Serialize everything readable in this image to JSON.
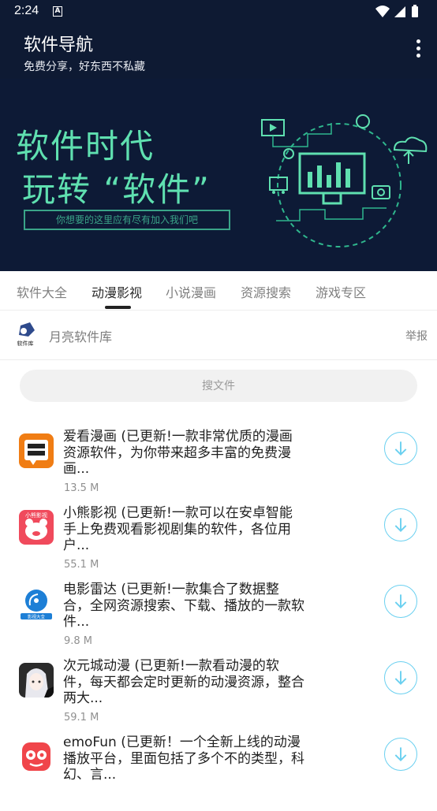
{
  "status_bar": {
    "time": "2:24",
    "notification_icon": "A"
  },
  "app_bar": {
    "title": "软件导航",
    "subtitle": "免费分享，好东西不私藏",
    "more_icon": "more-vert-icon"
  },
  "banner": {
    "line1": "软件时代",
    "line2": "玩转 “软件”",
    "pill_text": "你想要的这里应有尽有加入我们吧"
  },
  "tabs": [
    {
      "label": "软件大全",
      "active": false
    },
    {
      "label": "动漫影视",
      "active": true
    },
    {
      "label": "小说漫画",
      "active": false
    },
    {
      "label": "资源搜索",
      "active": false
    },
    {
      "label": "游戏专区",
      "active": false
    }
  ],
  "source": {
    "name": "月亮软件库",
    "report_label": "举报",
    "logo_text": "软件库"
  },
  "search": {
    "placeholder": "搜文件"
  },
  "items": [
    {
      "description": "爱看漫画 (已更新!一款非常优质的漫画资源软件，为你带来超多丰富的免费漫画...",
      "size": "13.5 M",
      "icon": "comic-app-icon"
    },
    {
      "description": "小熊影视 (已更新!一款可以在安卓智能手上免费观看影视剧集的软件，各位用户...",
      "size": "55.1 M",
      "icon": "bear-app-icon",
      "icon_text": "小熊影视"
    },
    {
      "description": "电影雷达 (已更新!一款集合了数据整合，全网资源搜索、下载、播放的一款软件...",
      "size": "9.8 M",
      "icon": "radar-app-icon",
      "icon_text": "影视大全"
    },
    {
      "description": "次元城动漫 (已更新!一款看动漫的软件，每天都会定时更新的动漫资源，整合两大...",
      "size": "59.1 M",
      "icon": "anime-girl-app-icon"
    },
    {
      "description": "emoFun (已更新！一个全新上线的动漫播放平台，里面包括了多个不的类型，科幻、言...",
      "size": "",
      "icon": "emofun-app-icon"
    }
  ],
  "colors": {
    "header_bg": "#0e1a33",
    "banner_accent": "#5fe0b0",
    "download_ring": "#6ad0f0"
  }
}
